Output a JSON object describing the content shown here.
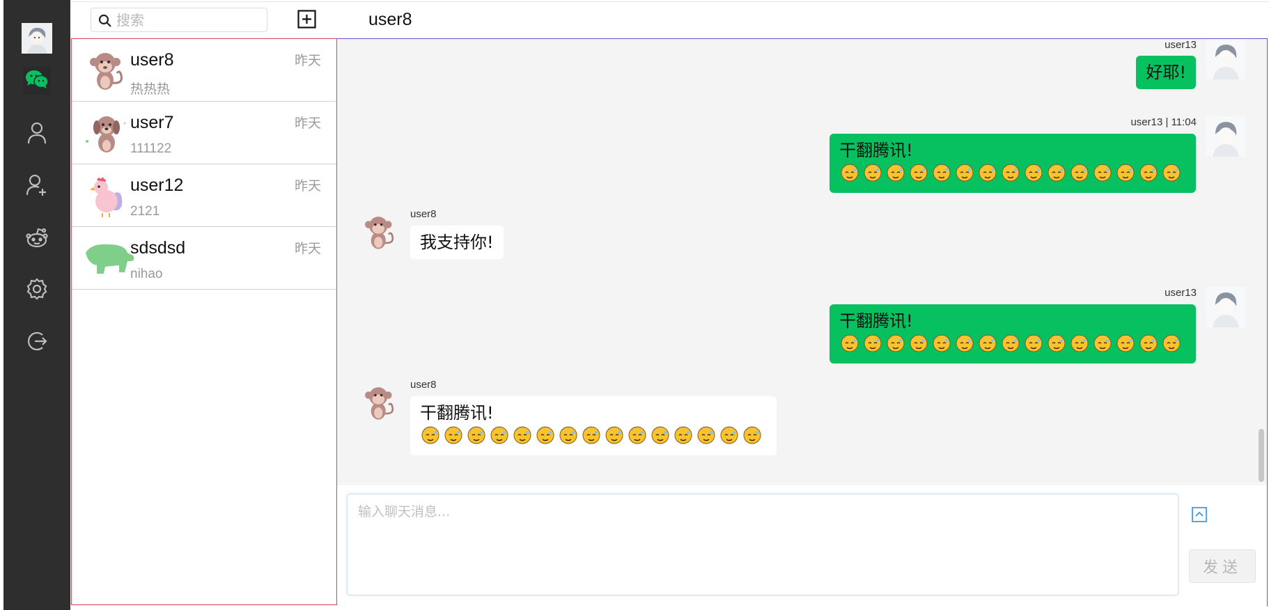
{
  "nav": {
    "items": [
      {
        "icon": "chat-icon",
        "active": true
      },
      {
        "icon": "person-icon",
        "active": false
      },
      {
        "icon": "add-friend-icon",
        "active": false
      },
      {
        "icon": "robot-icon",
        "active": false
      },
      {
        "icon": "gear-icon",
        "active": false
      },
      {
        "icon": "logout-icon",
        "active": false
      }
    ],
    "accent": "#07c160"
  },
  "search": {
    "placeholder": "搜索"
  },
  "header": {
    "title": "user8"
  },
  "contacts": [
    {
      "name": "user8",
      "time": "昨天",
      "preview": "热热热",
      "avatar": "monkey"
    },
    {
      "name": "user7",
      "time": "昨天",
      "preview": "111122",
      "avatar": "dog"
    },
    {
      "name": "user12",
      "time": "昨天",
      "preview": "2121",
      "avatar": "chicken"
    },
    {
      "name": "sdsdsd",
      "time": "昨天",
      "preview": "nihao",
      "avatar": "bear"
    }
  ],
  "messages": [
    {
      "side": "right",
      "sender": "user13",
      "text": "好耶!",
      "emoji_count": 0
    },
    {
      "side": "right",
      "sender": "user13 | 11:04",
      "text": "干翻腾讯!",
      "emoji_count": 15
    },
    {
      "side": "left",
      "sender": "user8",
      "text": "我支持你!",
      "emoji_count": 0
    },
    {
      "side": "right",
      "sender": "user13",
      "text": "干翻腾讯!",
      "emoji_count": 15
    },
    {
      "side": "left",
      "sender": "user8",
      "text": "干翻腾讯!",
      "emoji_count": 15
    }
  ],
  "composer": {
    "placeholder": "输入聊天消息...",
    "send_label": "发送"
  }
}
